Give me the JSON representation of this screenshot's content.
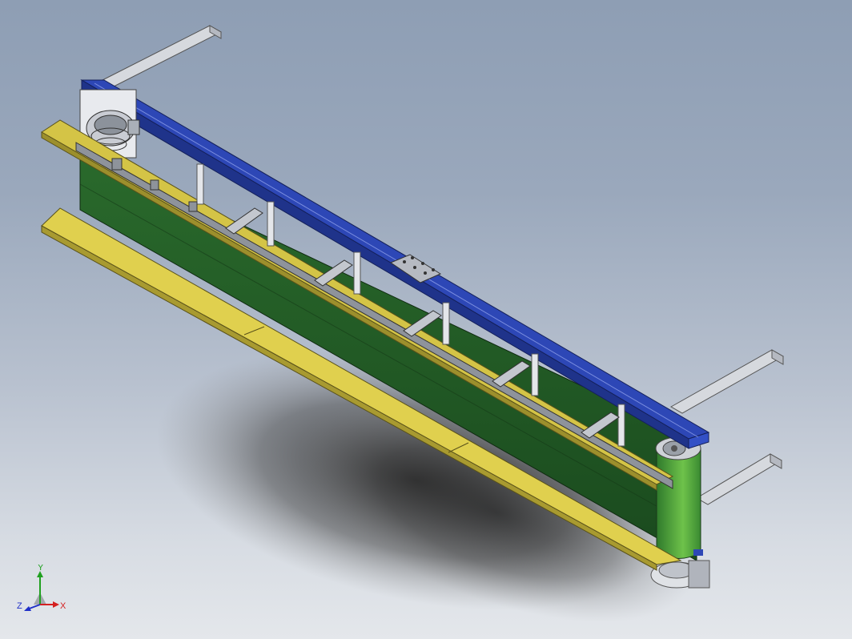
{
  "viewport": {
    "background_top": "#8e9eb4",
    "background_bottom": "#e4e7eb"
  },
  "model": {
    "belt_color": "#1f4f22",
    "frame_color": "#2d47b6",
    "guard_rail_color": "#d4c446",
    "shaft_color": "#c9ccd3"
  },
  "triad": {
    "x_label": "X",
    "y_label": "Y",
    "z_label": "Z",
    "x_color": "#d42020",
    "y_color": "#20a020",
    "z_color": "#2030c8"
  }
}
